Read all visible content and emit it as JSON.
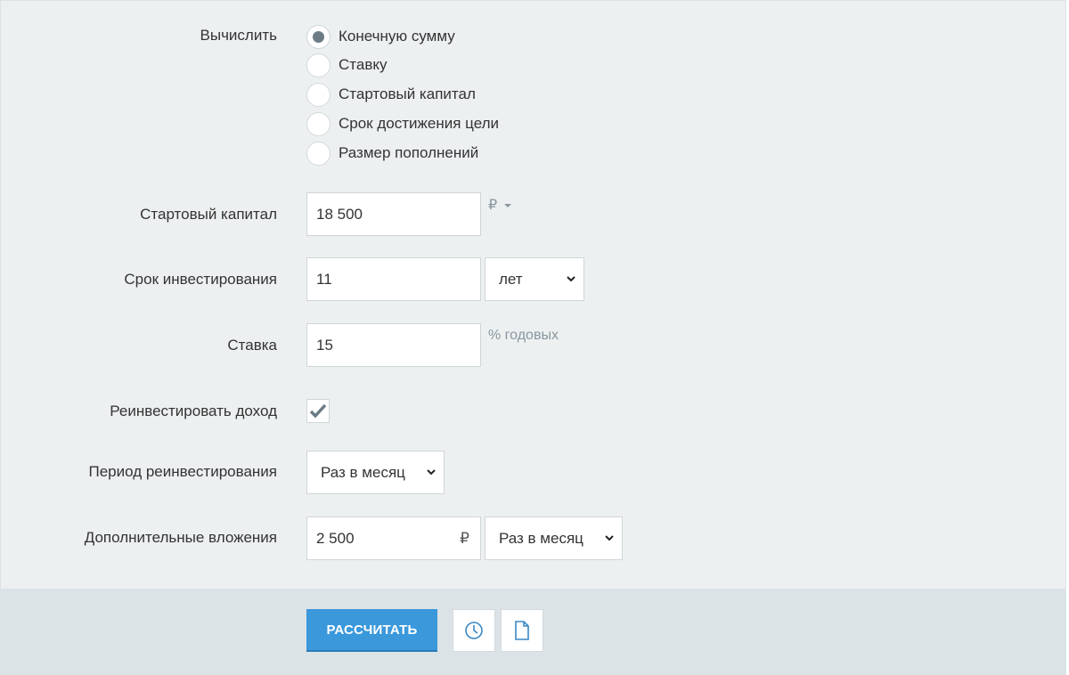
{
  "calculate": {
    "label": "Вычислить",
    "options": [
      {
        "label": "Конечную сумму",
        "checked": true
      },
      {
        "label": "Ставку",
        "checked": false
      },
      {
        "label": "Стартовый капитал",
        "checked": false
      },
      {
        "label": "Срок достижения цели",
        "checked": false
      },
      {
        "label": "Размер пополнений",
        "checked": false
      }
    ]
  },
  "start_capital": {
    "label": "Стартовый капитал",
    "value": "18 500",
    "currency": "₽"
  },
  "term": {
    "label": "Срок инвестирования",
    "value": "11",
    "unit": "лет"
  },
  "rate": {
    "label": "Ставка",
    "value": "15",
    "unit": "% годовых"
  },
  "reinvest": {
    "label": "Реинвестировать доход",
    "checked": true
  },
  "reinvest_period": {
    "label": "Период реинвестирования",
    "value": "Раз в месяц"
  },
  "additional": {
    "label": "Дополнительные вложения",
    "value": "2 500",
    "currency": "₽",
    "period": "Раз в месяц"
  },
  "footer": {
    "calculate_button": "РАССЧИТАТЬ",
    "history_icon": "clock-icon",
    "document_icon": "document-icon"
  },
  "colors": {
    "accent": "#3a98db",
    "panel_bg": "#ecf0f1",
    "footer_bg": "#dce3e6"
  }
}
